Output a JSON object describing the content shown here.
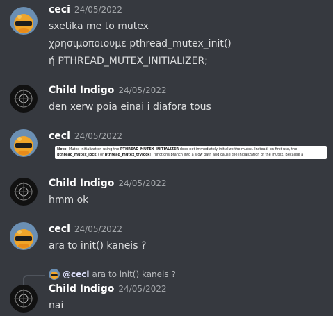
{
  "messages": [
    {
      "author": "ceci",
      "time": "24/05/2022",
      "lines": [
        "sxetika me to mutex",
        "χρησιμοποιουμε  pthread_mutex_init()",
        "ή  PTHREAD_MUTEX_INITIALIZER;"
      ]
    },
    {
      "author": "Child Indigo",
      "time": "24/05/2022",
      "lines": [
        "den xerw poia einai i diafora tous"
      ]
    },
    {
      "author": "ceci",
      "time": "24/05/2022",
      "note": {
        "label": "Note:",
        "t1": " Mutex initialization using the ",
        "k1": "PTHREAD_MUTEX_INITIALIZER",
        "t2": " does not immediately initialize the mutex. Instead, on first use, the",
        "k2": "pthread_mutex_lock",
        "t3": "() or ",
        "k3": "pthread_mutex_trylock",
        "t4": "() functions branch into a slow path and cause the initialization of the mutex. Because a"
      }
    },
    {
      "author": "Child Indigo",
      "time": "24/05/2022",
      "lines": [
        "hmm ok"
      ]
    },
    {
      "author": "ceci",
      "time": "24/05/2022",
      "lines": [
        "ara to init() kaneis ?"
      ]
    },
    {
      "author": "Child Indigo",
      "time": "24/05/2022",
      "reply": {
        "mention": "@ceci",
        "text": "ara to init() kaneis ?"
      },
      "lines": [
        "nai"
      ]
    }
  ],
  "colors": {
    "background": "#36393f",
    "author": "#ffffff",
    "text": "#dcddde",
    "timestamp": "#a3a6aa"
  },
  "icons": {
    "ceci_avatar": "duck-with-sunglasses-icon",
    "indigo_avatar": "dark-pattern-avatar-icon"
  }
}
